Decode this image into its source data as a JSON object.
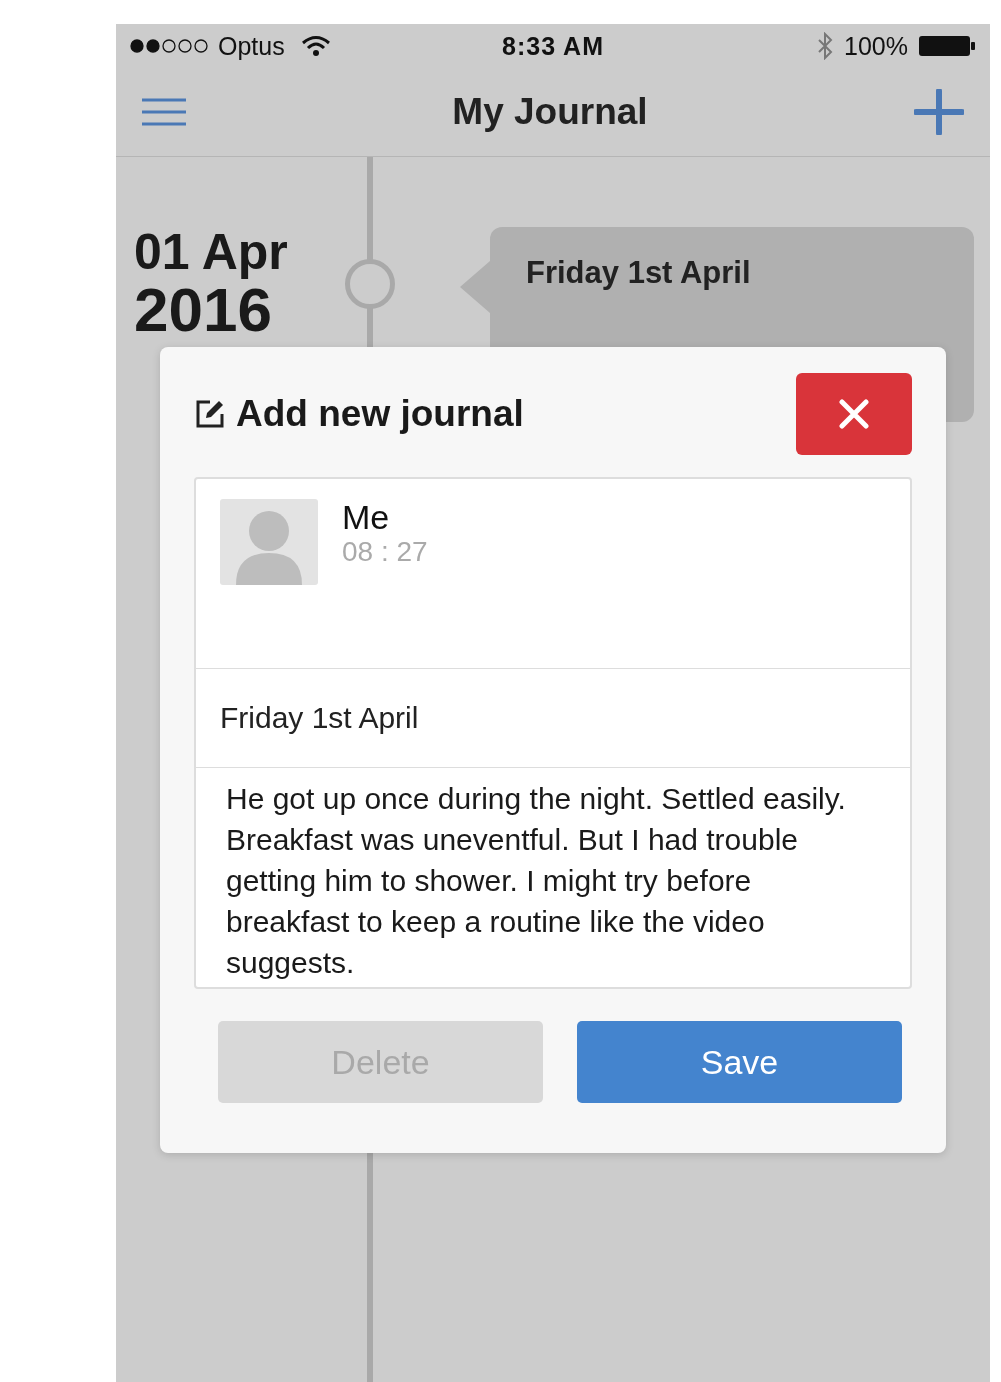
{
  "status_bar": {
    "carrier": "Optus",
    "time": "8:33 AM",
    "battery": "100%"
  },
  "nav_bar": {
    "title": "My Journal"
  },
  "timeline": {
    "day": "01 Apr",
    "year": "2016",
    "entry_title": "Friday 1st April"
  },
  "dialog": {
    "title": "Add new journal",
    "author": "Me",
    "time": "08 : 27",
    "entry_title": "Friday 1st April",
    "body": "He got up once during the night. Settled easily. Breakfast was uneventful. But I had trouble getting him to shower. I might try before breakfast to keep a routine like the video suggests.",
    "buttons": [
      {
        "label": "Delete",
        "disabled": true
      },
      {
        "label": "Save",
        "disabled": false
      }
    ]
  }
}
